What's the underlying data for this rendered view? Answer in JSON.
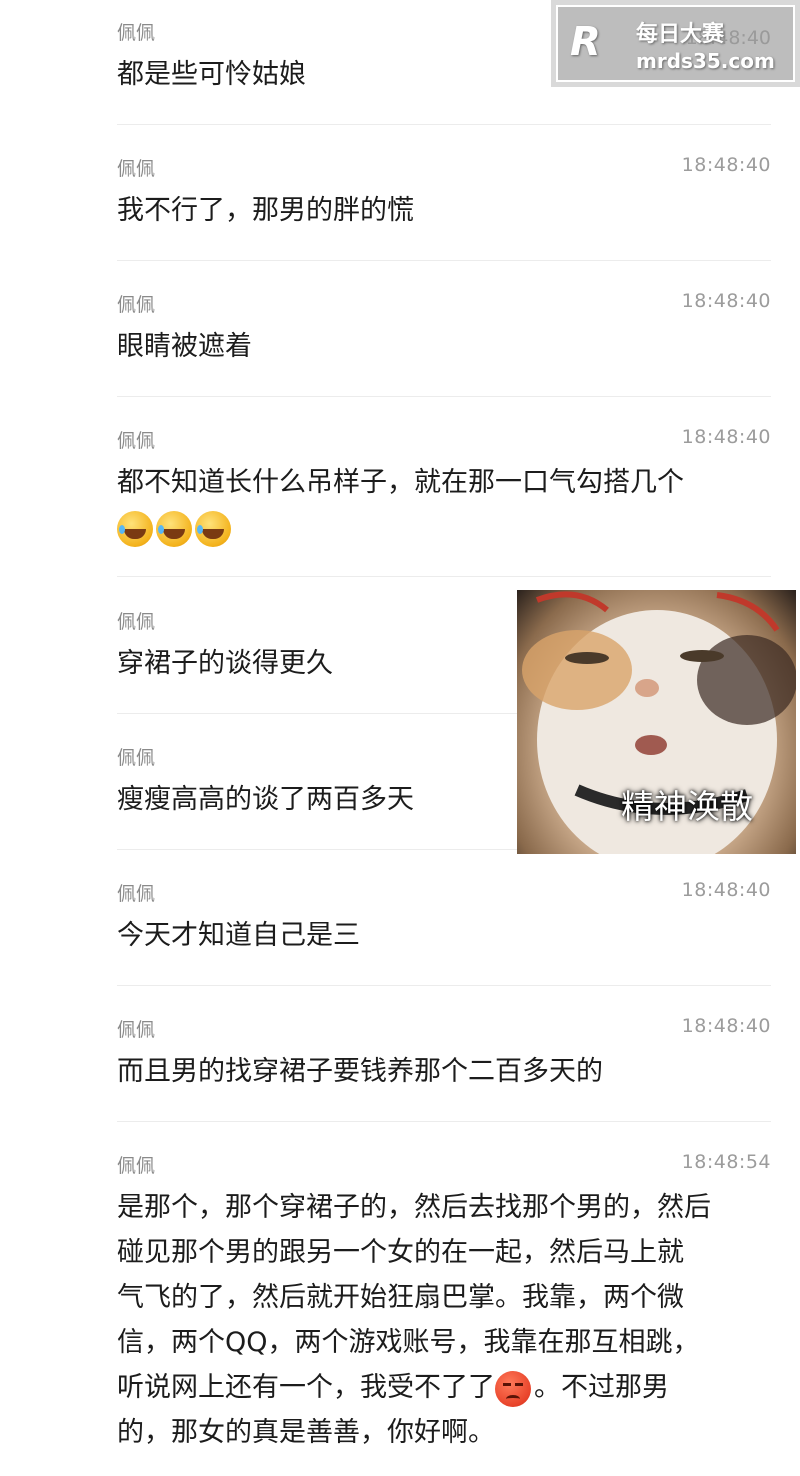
{
  "watermark": {
    "logo": "R",
    "line1": "每日大赛",
    "line2": "mrds35.com"
  },
  "messages": [
    {
      "sender": "佩佩",
      "time": "18:48:40",
      "text": "都是些可怜姑娘"
    },
    {
      "sender": "佩佩",
      "time": "18:48:40",
      "text": "我不行了，那男的胖的慌"
    },
    {
      "sender": "佩佩",
      "time": "18:48:40",
      "text": "眼睛被遮着"
    },
    {
      "sender": "佩佩",
      "time": "18:48:40",
      "text": "都不知道长什么吊样子，就在那一口气勾搭几个",
      "emojis": [
        "laughing-tears-emoji",
        "laughing-tears-emoji",
        "laughing-tears-emoji"
      ]
    },
    {
      "sender": "佩佩",
      "time": "",
      "text": "穿裙子的谈得更久"
    },
    {
      "sender": "佩佩",
      "time": "",
      "text": "瘦瘦高高的谈了两百多天"
    },
    {
      "sender": "佩佩",
      "time": "18:48:40",
      "text": "今天才知道自己是三"
    },
    {
      "sender": "佩佩",
      "time": "18:48:40",
      "text": "而且男的找穿裙子要钱养那个二百多天的"
    },
    {
      "sender": "佩佩",
      "time": "18:48:54",
      "text_lines": [
        "是那个，那个穿裙子的，然后去找那个男的，然后",
        "碰见那个男的跟另一个女的在一起，然后马上就",
        "气飞的了，然后就开始狂扇巴掌。我靠，两个微",
        "信，两个QQ，两个游戏账号，我靠在那互相跳，",
        "听说网上还有一个，我受不了了",
        "的，那女的真是善善，你好啊。"
      ],
      "line5_after_emoji": "。不过那男"
    }
  ],
  "sticker": {
    "caption": "精神涣散",
    "icon": "cat-meme-sticker"
  }
}
